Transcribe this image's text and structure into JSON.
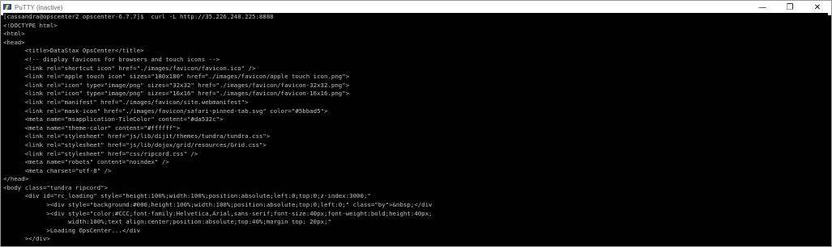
{
  "window": {
    "title": "PuTTY (inactive)",
    "minimize_glyph": "—",
    "maximize_glyph": "❐",
    "close_glyph": "✕"
  },
  "terminal": {
    "text_color": "#c0c0c0",
    "background": "#000000",
    "lines": [
      "[cassandra@opscenter2 opscenter-6.7.7]$  curl -L http://35.226.248.225:8888",
      "<!DOCTYPE html>",
      "<html>",
      "<head>",
      "      <title>DataStax OpsCenter</title>",
      "      <!-- display favicons for browsers and touch icons -->",
      "      <link rel=\"shortcut icon\" href=\"./images/favicon/favicon.ico\" />",
      "      <link rel=\"apple touch icon\" sizes=\"180x180\" href=\"./images/favicon/apple touch icon.png\">",
      "      <link rel=\"icon\" type=\"image/png\" sizes=\"32x32\" href=\"./images/favicon/favicon-32x32.png\">",
      "      <link rel=\"icon\" type=\"image/png\" sizes=\"16x16\" href=\"./images/favicon/favicon-16x16.png\">",
      "      <link rel=\"manifest\" href=\"./images/favicon/site.webmanifest\">",
      "      <link rel=\"mask-icon\" href=\"./images/favicon/safari-pinned-tab.svg\" color=\"#5bbad5\">",
      "      <meta name=\"msapplication-TileColor\" content=\"#da532c\">",
      "      <meta name=\"theme-color\" content=\"#ffffff\">",
      "      <link rel=\"stylesheet\" href=\"js/lib/dijit/themes/tundra/tundra.css\">",
      "      <link rel=\"stylesheet\" href=\"js/lib/dojox/grid/resources/Grid.css\">",
      "      <link rel=\"stylesheet\" href=\"css/ripcord.css\" />",
      "      <meta name=\"robots\" content=\"noindex\" />",
      "      <meta charset=\"utf-8\" />",
      "</head>",
      "<body class=\"tundra ripcord\">",
      "      <div id=\"rc_loading\" style=\"height:100%;width:100%;position:absolute;left:0;top:0;z-index:3000;\"",
      "            ><div style=\"background:#000;height:100%;width:100%;position:absolute;top:0;left:0;\" class=\"by\">&nbsp;</div",
      "            ><div style=\"color:#CCC;font-family:Helvetica,Arial,sans-serif;font-size:40px;font-weight:bold;height:40px;",
      "                  width:100%;text align:center;position:absolute;top:40%;margin top: 20px;\"",
      "            >Loading OpsCenter...</div",
      "      ></div>"
    ]
  }
}
